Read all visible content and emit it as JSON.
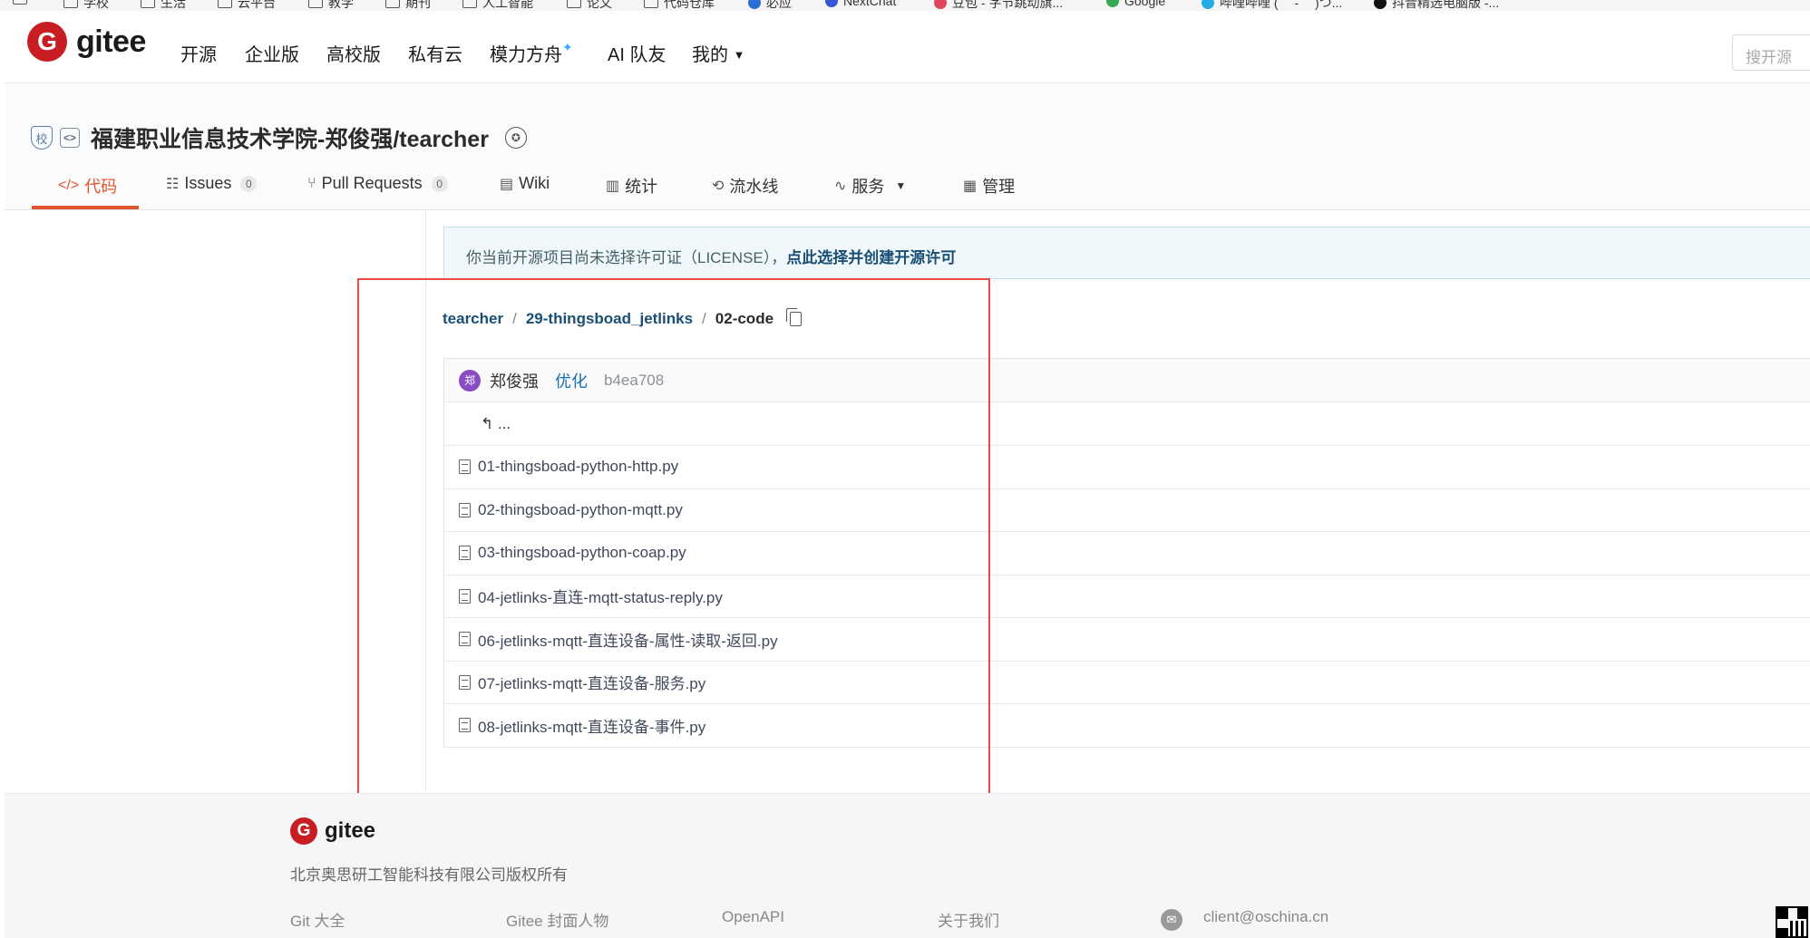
{
  "bookmarks": [
    {
      "label": "学校"
    },
    {
      "label": "生活"
    },
    {
      "label": "云平台"
    },
    {
      "label": "教学"
    },
    {
      "label": "期刊"
    },
    {
      "label": "人工智能"
    },
    {
      "label": "论文"
    },
    {
      "label": "代码仓库"
    },
    {
      "label": "必应"
    },
    {
      "label": "NextChat"
    },
    {
      "label": "豆包 - 字节跳动旗..."
    },
    {
      "label": "Google"
    },
    {
      "label": "哔哩哔哩 ( ゜- ゜)つ..."
    },
    {
      "label": "抖音精选电脑版 -..."
    }
  ],
  "header": {
    "logo_text": "gitee",
    "logo_glyph": "G",
    "nav": [
      "开源",
      "企业版",
      "高校版",
      "私有云",
      "模力方舟",
      "AI 队友",
      "我的"
    ],
    "search_placeholder": "搜开源"
  },
  "repo": {
    "school_badge": "校",
    "code_badge": "<>",
    "full_name": "福建职业信息技术学院-郑俊强/tearcher",
    "tabs": [
      {
        "label": "代码",
        "icon": "</>"
      },
      {
        "label": "Issues",
        "count": "0",
        "icon": "☷"
      },
      {
        "label": "Pull Requests",
        "count": "0",
        "icon": "⑂"
      },
      {
        "label": "Wiki",
        "icon": "▤"
      },
      {
        "label": "统计",
        "icon": "▥"
      },
      {
        "label": "流水线",
        "icon": "⟲"
      },
      {
        "label": "服务",
        "icon": "∿"
      },
      {
        "label": "管理",
        "icon": "▦"
      }
    ]
  },
  "notice": {
    "text": "你当前开源项目尚未选择许可证（LICENSE），",
    "link": "点此选择并创建开源许可"
  },
  "breadcrumb": {
    "root": "tearcher",
    "sep": "/",
    "folder": "29-thingsboad_jetlinks",
    "current": "02-code"
  },
  "commit": {
    "avatar": "郑",
    "author": "郑俊强",
    "message": "优化",
    "sha": "b4ea708"
  },
  "up_dir": "↰ ...",
  "files": [
    "01-thingsboad-python-http.py",
    "02-thingsboad-python-mqtt.py",
    "03-thingsboad-python-coap.py",
    "04-jetlinks-直连-mqtt-status-reply.py",
    "06-jetlinks-mqtt-直连设备-属性-读取-返回.py",
    "07-jetlinks-mqtt-直连设备-服务.py",
    "08-jetlinks-mqtt-直连设备-事件.py"
  ],
  "footer": {
    "logo_text": "gitee",
    "copyright": "北京奥思研工智能科技有限公司版权所有",
    "links": [
      "Git 大全",
      "Gitee 封面人物",
      "OpenAPI",
      "关于我们"
    ],
    "email": "client@oschina.cn"
  },
  "colors": {
    "brand": "#c71d23",
    "active_tab": "#e1552d",
    "link": "#1a4f75",
    "highlight_box": "#e84a4a"
  }
}
